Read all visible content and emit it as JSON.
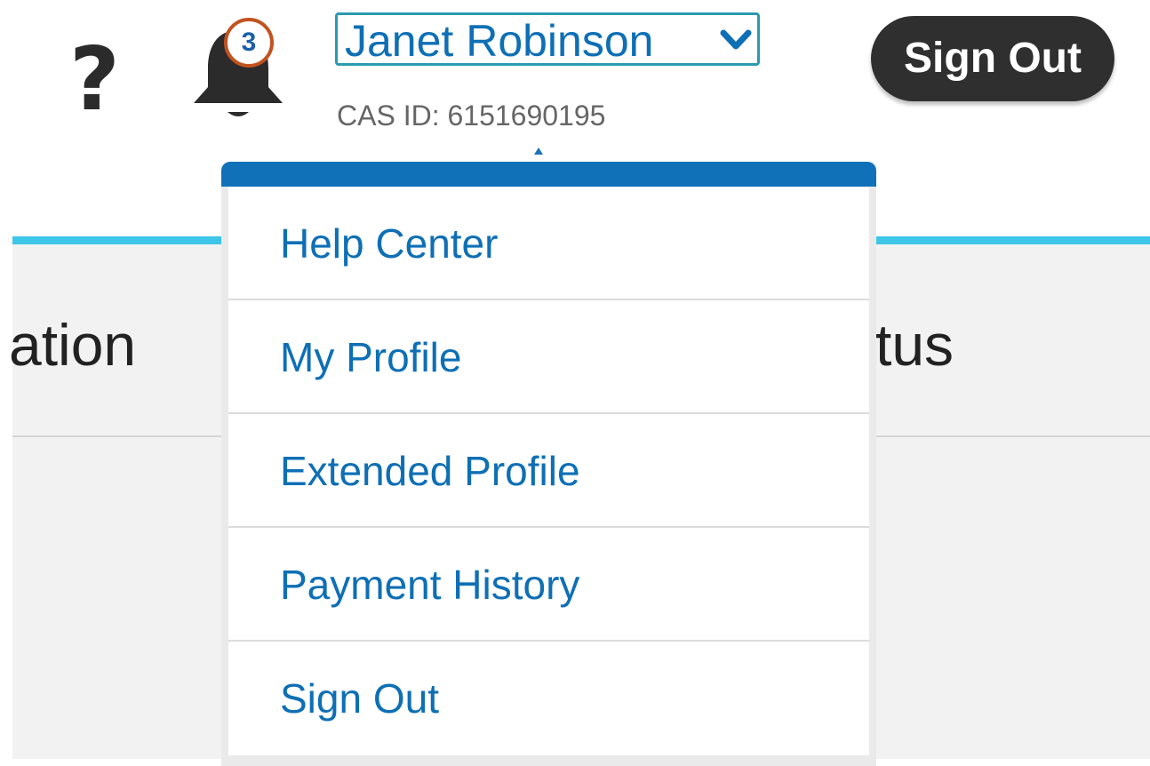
{
  "header": {
    "help_glyph": "?",
    "notifications": {
      "count": "3"
    },
    "user": {
      "name": "Janet Robinson",
      "cas_id": "CAS ID: 6151690195"
    },
    "sign_out_label": "Sign Out"
  },
  "tabs": {
    "left_partial": "ation",
    "right_partial": "tus"
  },
  "dropdown": {
    "items": [
      {
        "label": "Help Center"
      },
      {
        "label": "My Profile"
      },
      {
        "label": "Extended Profile"
      },
      {
        "label": "Payment History"
      },
      {
        "label": "Sign Out"
      }
    ]
  },
  "colors": {
    "link_blue": "#0e6fb5",
    "dropdown_header": "#1071b9",
    "accent_cyan": "#3dc6e8",
    "badge_ring": "#c2531f",
    "toggle_outline": "#2a9bb0",
    "button_dark": "#2f2f2f"
  },
  "icons": {
    "help": "question-mark-icon",
    "notifications": "bell-icon",
    "user_menu_toggle": "chevron-down-icon"
  }
}
